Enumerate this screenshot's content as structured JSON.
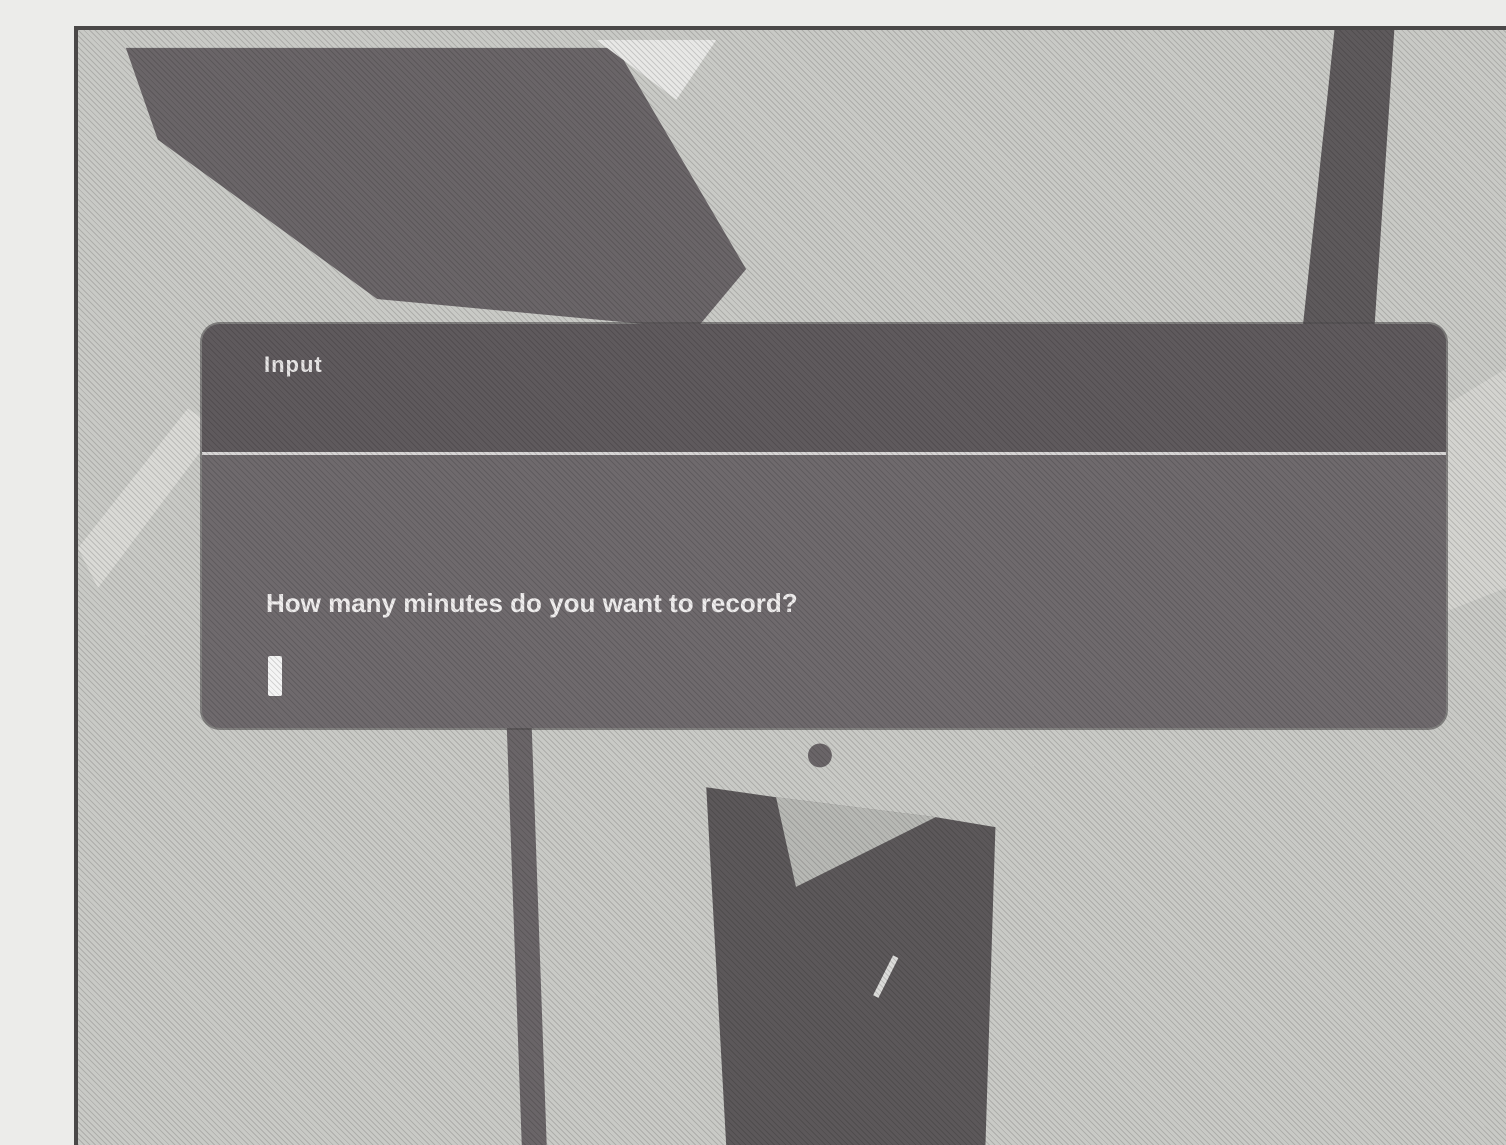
{
  "dialog": {
    "title": "Input",
    "question": "How many minutes do you want to record?",
    "input_value": "",
    "input_placeholder": ""
  },
  "colors": {
    "dialog_background": "#6f6a6d",
    "dialog_header": "#5f5a5d",
    "text": "#f0eeee",
    "scene_background": "#c7c8c4"
  },
  "icons": {
    "text_cursor": "text-cursor-icon"
  }
}
